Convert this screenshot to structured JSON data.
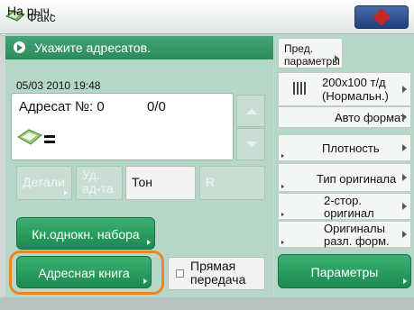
{
  "header": {
    "title": "Факс",
    "icons": [
      "fax-icon",
      "device-status-icon"
    ]
  },
  "message": "Укажите адресатов.",
  "datetime": "05/03 2010 19:48",
  "destination": {
    "label": "Адресат №",
    "number": ": 0",
    "count": "0/0"
  },
  "buttons": {
    "details": "Детали",
    "delete": "Уд. ад-та",
    "tone": "Тон",
    "r": "R",
    "speed_dial": "Кн.однокн. набора",
    "on_hook": "На рыч.",
    "address_book": "Адресная книга",
    "direct_send": "Прямая передача"
  },
  "right_panel": {
    "presets": "Пред. параметры",
    "resolution": "200x100 т/д (Нормальн.)",
    "size": "Авто формат",
    "density": "Плотность",
    "original_type": "Тип оригинала",
    "duplex": "2-стор. оригинал",
    "mixed": "Оригиналы разл. форм.",
    "params": "Параметры"
  },
  "colors": {
    "accent_green": "#2b8a5a",
    "highlight_orange": "#f0831f"
  }
}
